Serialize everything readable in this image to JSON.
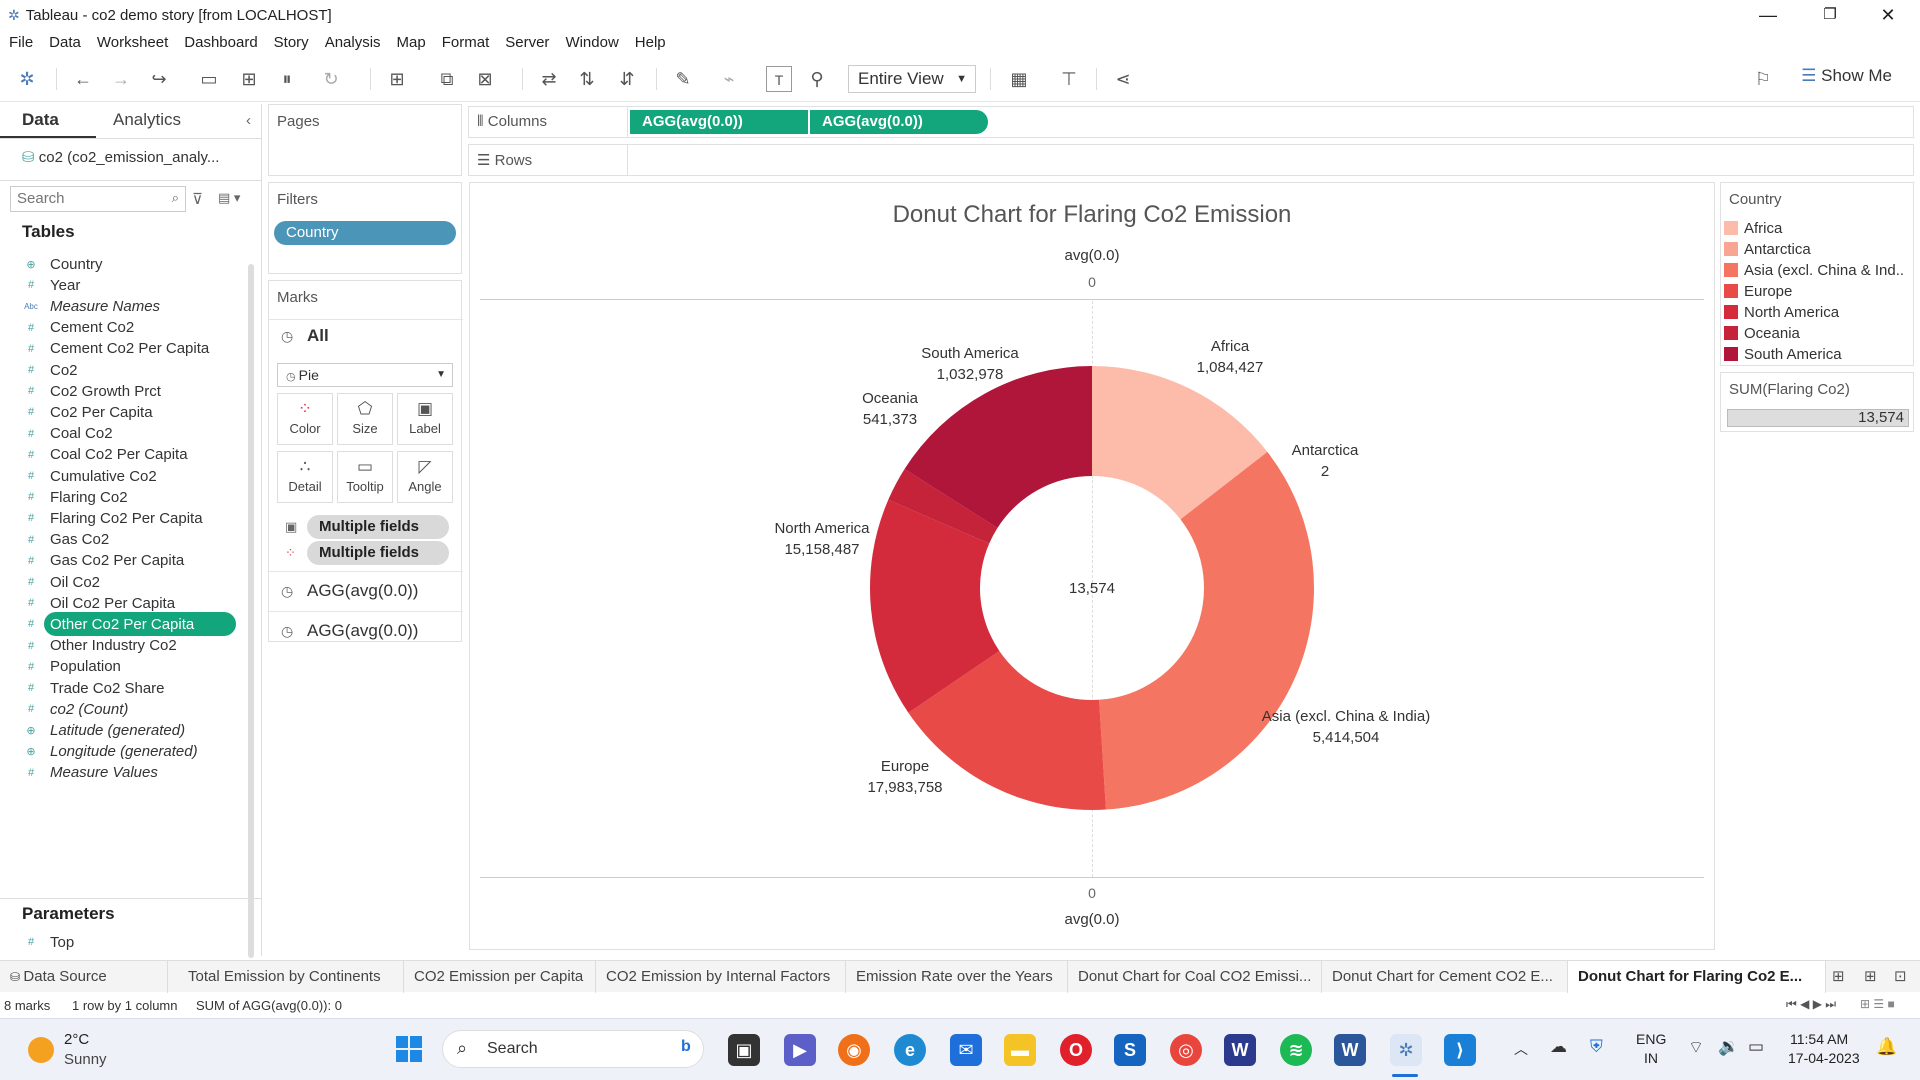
{
  "window": {
    "title": "Tableau - co2 demo story [from LOCALHOST]"
  },
  "menu": [
    "File",
    "Data",
    "Worksheet",
    "Dashboard",
    "Story",
    "Analysis",
    "Map",
    "Format",
    "Server",
    "Window",
    "Help"
  ],
  "toolbar": {
    "view_mode": "Entire View",
    "show_me": "Show Me"
  },
  "data_pane": {
    "tab_data": "Data",
    "tab_analytics": "Analytics",
    "datasource": "co2 (co2_emission_analy...",
    "search_placeholder": "Search",
    "tables_heading": "Tables",
    "fields": [
      {
        "icon": "⊕",
        "name": "Country",
        "italic": false
      },
      {
        "icon": "#",
        "name": "Year",
        "italic": false
      },
      {
        "icon": "Abc",
        "name": "Measure Names",
        "italic": true
      },
      {
        "icon": "#",
        "name": "Cement Co2",
        "italic": false
      },
      {
        "icon": "#",
        "name": "Cement Co2 Per Capita",
        "italic": false
      },
      {
        "icon": "#",
        "name": "Co2",
        "italic": false
      },
      {
        "icon": "#",
        "name": "Co2 Growth Prct",
        "italic": false
      },
      {
        "icon": "#",
        "name": "Co2 Per Capita",
        "italic": false
      },
      {
        "icon": "#",
        "name": "Coal Co2",
        "italic": false
      },
      {
        "icon": "#",
        "name": "Coal Co2 Per Capita",
        "italic": false
      },
      {
        "icon": "#",
        "name": "Cumulative Co2",
        "italic": false
      },
      {
        "icon": "#",
        "name": "Flaring Co2",
        "italic": false
      },
      {
        "icon": "#",
        "name": "Flaring Co2 Per Capita",
        "italic": false
      },
      {
        "icon": "#",
        "name": "Gas Co2",
        "italic": false
      },
      {
        "icon": "#",
        "name": "Gas Co2 Per Capita",
        "italic": false
      },
      {
        "icon": "#",
        "name": "Oil Co2",
        "italic": false
      },
      {
        "icon": "#",
        "name": "Oil Co2 Per Capita",
        "italic": false
      },
      {
        "icon": "#",
        "name": "Other Co2 Per Capita",
        "italic": false,
        "selected": true
      },
      {
        "icon": "#",
        "name": "Other Industry Co2",
        "italic": false
      },
      {
        "icon": "#",
        "name": "Population",
        "italic": false
      },
      {
        "icon": "#",
        "name": "Trade Co2 Share",
        "italic": false
      },
      {
        "icon": "#",
        "name": "co2 (Count)",
        "italic": true
      },
      {
        "icon": "⊕",
        "name": "Latitude (generated)",
        "italic": true
      },
      {
        "icon": "⊕",
        "name": "Longitude (generated)",
        "italic": true
      },
      {
        "icon": "#",
        "name": "Measure Values",
        "italic": true
      }
    ],
    "parameters_heading": "Parameters",
    "parameters": [
      {
        "icon": "#",
        "name": "Top"
      }
    ]
  },
  "shelves": {
    "pages_title": "Pages",
    "filters_title": "Filters",
    "filter_pill": "Country",
    "marks_title": "Marks",
    "marks_all": "All",
    "mark_type": "Pie",
    "mark_buttons": [
      "Color",
      "Size",
      "Label",
      "Detail",
      "Tooltip",
      "Angle"
    ],
    "mark_fields": [
      "Multiple fields",
      "Multiple fields"
    ],
    "agg_cards": [
      "AGG(avg(0.0))",
      "AGG(avg(0.0))"
    ],
    "columns_label": "Columns",
    "rows_label": "Rows",
    "column_pills": [
      "AGG(avg(0.0))",
      "AGG(avg(0.0))"
    ]
  },
  "view": {
    "title": "Donut Chart for Flaring Co2 Emission",
    "axis_top_label": "avg(0.0)",
    "axis_top_tick": "0",
    "axis_bottom_tick": "0",
    "axis_bottom_label": "avg(0.0)",
    "center_value": "13,574"
  },
  "chart_data": {
    "type": "pie",
    "title": "Donut Chart for Flaring Co2 Emission",
    "categories": [
      "Africa",
      "Antarctica",
      "Asia (excl. China & India)",
      "Europe",
      "North America",
      "Oceania",
      "South America"
    ],
    "values": [
      1084427,
      2,
      5414504,
      17983758,
      15158487,
      541373,
      1032978
    ],
    "value_labels": [
      "1,084,427",
      "2",
      "5,414,504",
      "17,983,758",
      "15,158,487",
      "541,373",
      "1,032,978"
    ],
    "slice_fractions_shown": [
      0.145,
      0.0,
      0.345,
      0.165,
      0.16,
      0.025,
      0.16
    ],
    "colors": [
      "#fdbba9",
      "#f9a593",
      "#f47561",
      "#e84a48",
      "#d42b3c",
      "#c5233a",
      "#b0153a"
    ],
    "hole": true,
    "center_label": "13,574"
  },
  "legend": {
    "title": "Country",
    "items": [
      {
        "label": "Africa",
        "color": "#fdbba9"
      },
      {
        "label": "Antarctica",
        "color": "#f9a593"
      },
      {
        "label": "Asia (excl. China & Ind..",
        "color": "#f47561"
      },
      {
        "label": "Europe",
        "color": "#e84a48"
      },
      {
        "label": "North America",
        "color": "#d42b3c"
      },
      {
        "label": "Oceania",
        "color": "#c5233a"
      },
      {
        "label": "South America",
        "color": "#b0153a"
      }
    ],
    "size_title": "SUM(Flaring Co2)",
    "size_value": "13,574"
  },
  "sheet_tabs": [
    {
      "label": "Data Source",
      "active": false
    },
    {
      "label": "Total Emission by Continents",
      "active": false
    },
    {
      "label": "CO2 Emission per Capita",
      "active": false
    },
    {
      "label": "CO2 Emission by Internal Factors",
      "active": false
    },
    {
      "label": "Emission Rate over the Years",
      "active": false
    },
    {
      "label": "Donut Chart for Coal CO2 Emissi...",
      "active": false
    },
    {
      "label": "Donut Chart for Cement CO2 E...",
      "active": false
    },
    {
      "label": "Donut Chart for Flaring Co2 E...",
      "active": true
    }
  ],
  "status": {
    "marks": "8 marks",
    "rows": "1 row by 1 column",
    "sum": "SUM of AGG(avg(0.0)): 0"
  },
  "taskbar": {
    "weather_temp": "2°C",
    "weather_desc": "Sunny",
    "search": "Search",
    "lang1": "ENG",
    "lang2": "IN",
    "time": "11:54 AM",
    "date": "17-04-2023"
  }
}
